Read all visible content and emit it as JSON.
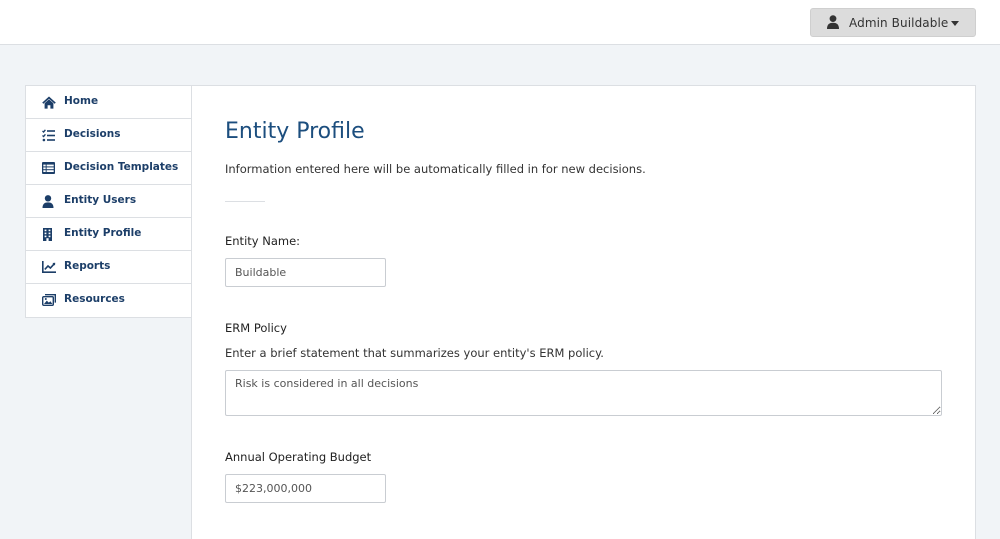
{
  "header": {
    "user_menu_label": "Admin Buildable"
  },
  "sidebar": {
    "items": [
      {
        "label": "Home",
        "icon": "home-icon"
      },
      {
        "label": "Decisions",
        "icon": "list-check-icon"
      },
      {
        "label": "Decision Templates",
        "icon": "table-list-icon"
      },
      {
        "label": "Entity Users",
        "icon": "user-icon"
      },
      {
        "label": "Entity Profile",
        "icon": "building-icon"
      },
      {
        "label": "Reports",
        "icon": "chart-line-icon"
      },
      {
        "label": "Resources",
        "icon": "images-icon"
      }
    ]
  },
  "main": {
    "title": "Entity Profile",
    "description": "Information entered here will be automatically filled in for new decisions.",
    "entity_name": {
      "label": "Entity Name:",
      "value": "Buildable"
    },
    "erm_policy": {
      "label": "ERM Policy",
      "help": "Enter a brief statement that summarizes your entity's ERM policy.",
      "value": "Risk is considered in all decisions"
    },
    "budget": {
      "label": "Annual Operating Budget",
      "value": "$223,000,000"
    }
  },
  "colors": {
    "accent": "#1c4e7e",
    "nav_text": "#1c3e68",
    "page_bg": "#f1f4f7"
  }
}
